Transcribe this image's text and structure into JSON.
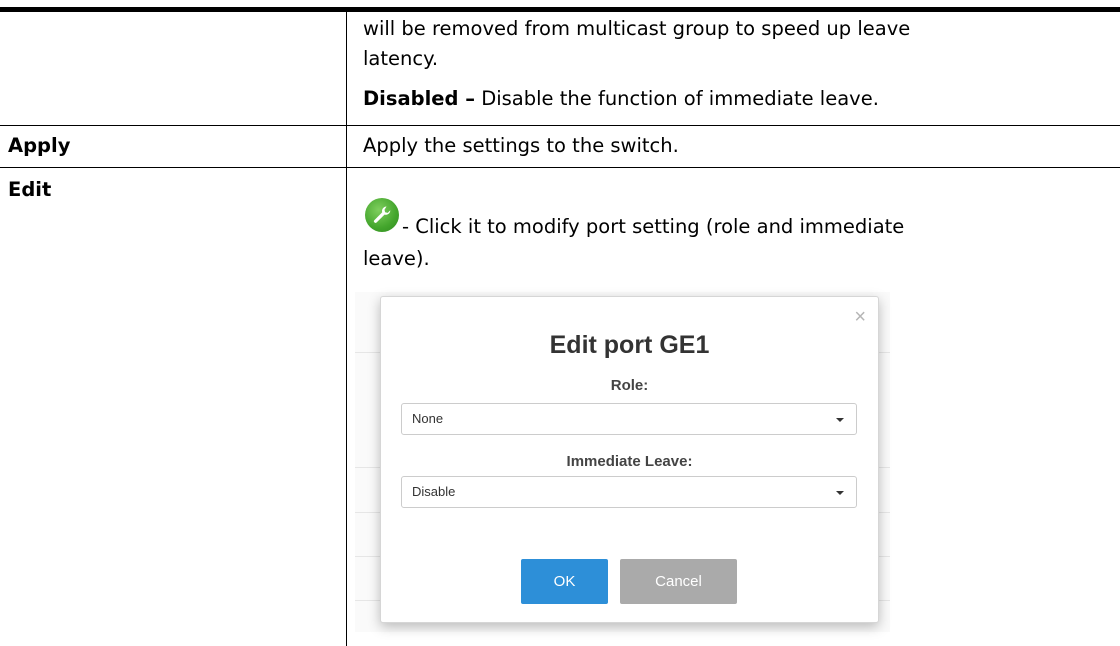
{
  "rows": {
    "continued": {
      "line1": "will be removed from multicast group to speed up leave",
      "line2": "latency.",
      "disabled_term": "Disabled –",
      "disabled_desc": " Disable the function of immediate leave."
    },
    "apply": {
      "term": "Apply",
      "desc": "Apply the settings to the switch."
    },
    "edit": {
      "term": "Edit",
      "desc_line1": "- Click it to modify port setting (role and immediate",
      "desc_line2": "leave).",
      "icon": "wrench-icon",
      "icon_color": "#43a52c"
    }
  },
  "dialog": {
    "title": "Edit port GE1",
    "close_glyph": "×",
    "role_label": "Role:",
    "role_value": "None",
    "leave_label": "Immediate Leave:",
    "leave_value": "Disable",
    "ok_label": "OK",
    "cancel_label": "Cancel",
    "ok_color": "#2d8fd8",
    "cancel_color": "#aaaaaa"
  }
}
